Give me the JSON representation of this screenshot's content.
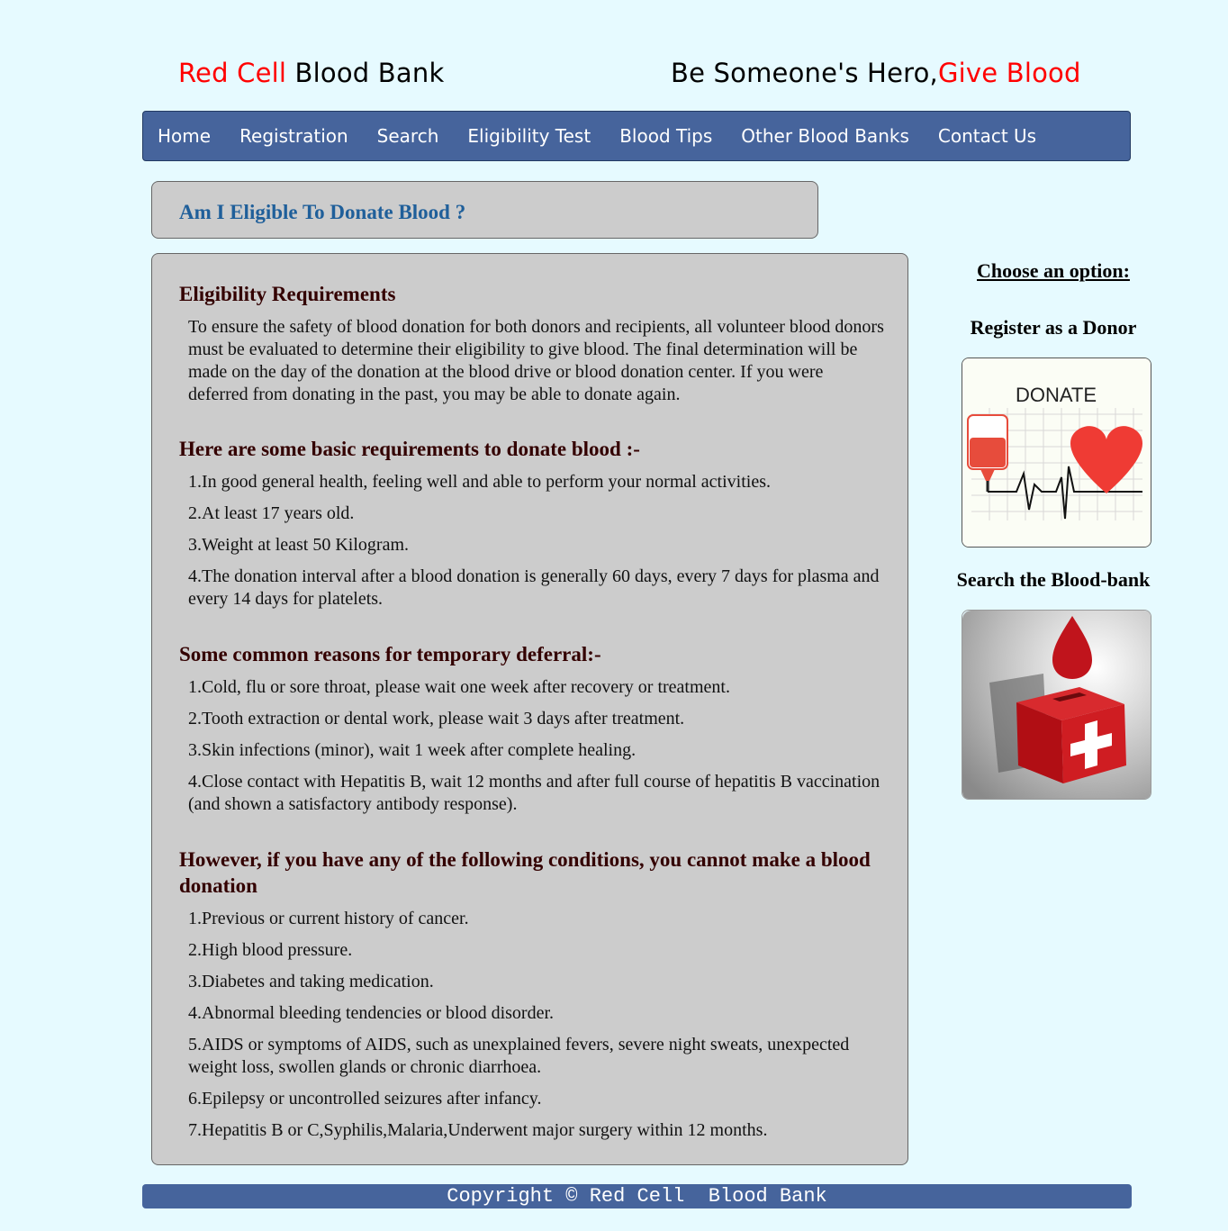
{
  "header": {
    "left_red": "Red Cell",
    "left_black": " Blood Bank",
    "right_black": "Be Someone's Hero,",
    "right_red": "Give Blood"
  },
  "nav": {
    "items": [
      {
        "label": "Home"
      },
      {
        "label": "Registration"
      },
      {
        "label": "Search"
      },
      {
        "label": "Eligibility Test"
      },
      {
        "label": "Blood Tips"
      },
      {
        "label": "Other Blood Banks"
      },
      {
        "label": "Contact Us"
      }
    ]
  },
  "page_title": "Am I Eligible To Donate Blood ?",
  "content": {
    "eligibility_heading": "Eligibility Requirements",
    "eligibility_text": "To ensure the safety of blood donation for both donors and recipients, all volunteer blood donors must be evaluated to determine their eligibility to give blood. The final determination will be made on the day of the donation at the blood drive or blood donation center. If you were deferred from donating in the past, you may be able to donate again.",
    "basic_heading": "Here are some basic requirements to donate blood :-",
    "basic_items": [
      "1.In good general health, feeling well and able to perform your normal activities.",
      "2.At least 17 years old.",
      "3.Weight at least 50 Kilogram.",
      "4.The donation interval after a blood donation is generally 60 days, every 7 days for plasma and every 14 days for platelets."
    ],
    "deferral_heading": "Some common reasons for temporary deferral:-",
    "deferral_items": [
      "1.Cold, flu or sore throat, please wait one week after recovery or treatment.",
      "2.Tooth extraction or dental work, please wait 3 days after treatment.",
      "3.Skin infections (minor), wait 1 week after complete healing.",
      "4.Close contact with Hepatitis B, wait 12 months and after full course of hepatitis B vaccination (and shown a satisfactory antibody response)."
    ],
    "cannot_heading": "However, if you have any of the following conditions, you cannot make a blood donation",
    "cannot_items": [
      "1.Previous or current history of cancer.",
      "2.High blood pressure.",
      "3.Diabetes and taking medication.",
      "4.Abnormal bleeding tendencies or blood disorder.",
      "5.AIDS or symptoms of AIDS, such as unexplained fevers, severe night sweats, unexpected weight loss, swollen glands or chronic diarrhoea.",
      "6.Epilepsy or uncontrolled seizures after infancy.",
      "7.Hepatitis B or C,Syphilis,Malaria,Underwent major surgery within 12 months."
    ]
  },
  "sidebar": {
    "choose_label": "Choose an option:",
    "register_label": "Register as a Donor",
    "donate_image_text": "DONATE",
    "search_label": "Search the Blood-bank"
  },
  "footer": {
    "text": "Copyright © Red Cell  Blood Bank"
  },
  "colors": {
    "background": "#e6faff",
    "navbar": "#46649c",
    "panel": "#cccccc",
    "title_blue": "#1f5f9a",
    "heading_maroon": "#330000",
    "brand_red": "#ff0000"
  }
}
